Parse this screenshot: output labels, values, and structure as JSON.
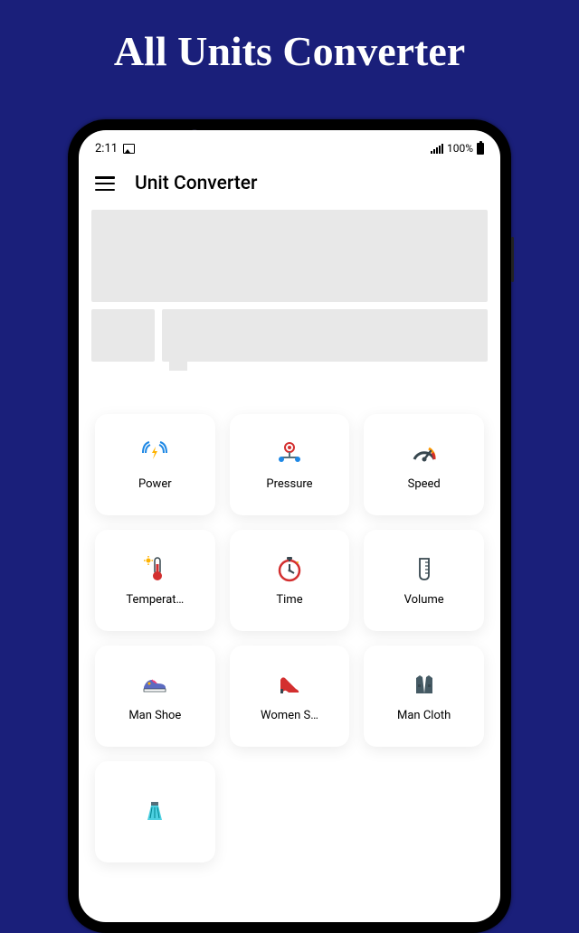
{
  "promo": {
    "title": "All Units Converter"
  },
  "status": {
    "time": "2:11",
    "battery": "100%"
  },
  "appbar": {
    "title": "Unit Converter"
  },
  "tiles": [
    {
      "label": "Power"
    },
    {
      "label": "Pressure"
    },
    {
      "label": "Speed"
    },
    {
      "label": "Temperat…"
    },
    {
      "label": "Time"
    },
    {
      "label": "Volume"
    },
    {
      "label": "Man Shoe"
    },
    {
      "label": "Women S…"
    },
    {
      "label": "Man Cloth"
    }
  ]
}
